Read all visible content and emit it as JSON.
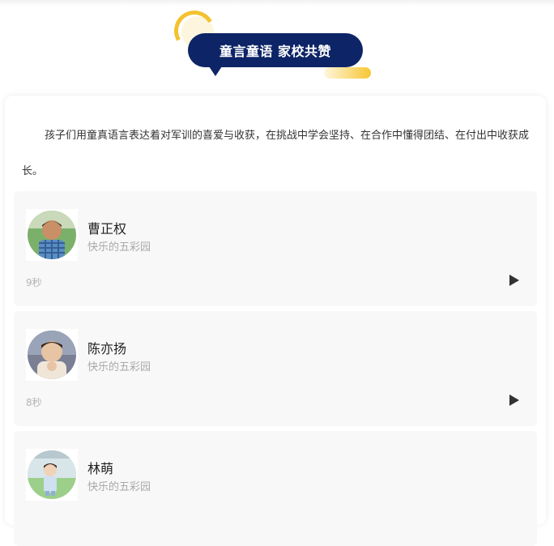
{
  "header": {
    "badge_text": "童言童语  家校共赞"
  },
  "intro": "孩子们用童真语言表达着对军训的喜爱与收获，在挑战中学会坚持、在合作中懂得团结、在付出中收获成长。",
  "items": [
    {
      "name": "曹正权",
      "subtitle": "快乐的五彩园",
      "duration": "9秒",
      "avatar_icon": "child-photo-icon"
    },
    {
      "name": "陈亦扬",
      "subtitle": "快乐的五彩园",
      "duration": "8秒",
      "avatar_icon": "child-photo-icon"
    },
    {
      "name": "林萌",
      "subtitle": "快乐的五彩园",
      "duration": "",
      "avatar_icon": "child-photo-icon"
    }
  ],
  "colors": {
    "badge_bg": "#0d2466",
    "accent_yellow": "#f3c230",
    "card_bg": "#f8f8f8"
  }
}
